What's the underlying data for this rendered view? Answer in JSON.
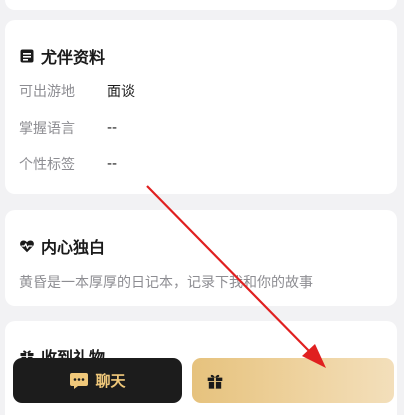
{
  "profile": {
    "title": "尤伴资料",
    "icon": "id-card-icon",
    "rows": [
      {
        "label": "可出游地",
        "value": "面谈"
      },
      {
        "label": "掌握语言",
        "value": "--"
      },
      {
        "label": "个性标签",
        "value": "--"
      }
    ]
  },
  "bio": {
    "title": "内心独白",
    "icon": "heartbeat-icon",
    "text": "黄昏是一本厚厚的日记本，记录下我和你的故事"
  },
  "gifts": {
    "title": "收到礼物",
    "icon": "gift-icon"
  },
  "bottom_bar": {
    "chat_label": "聊天",
    "chat_icon": "chat-bubble-icon",
    "gift_icon": "gift-icon"
  },
  "colors": {
    "background": "#f2f2f4",
    "card": "#ffffff",
    "chat_button_bg": "#1c1c1c",
    "chat_button_text": "#f0c87a",
    "gift_button_bg": "#e6c27d",
    "annotation_arrow": "#e02020"
  }
}
